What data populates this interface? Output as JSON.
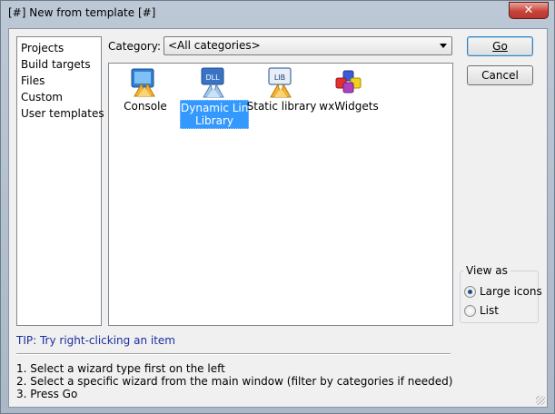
{
  "window": {
    "title": "[#] New from template [#]",
    "close_glyph": "✕"
  },
  "sidebar": {
    "items": [
      {
        "label": "Projects"
      },
      {
        "label": "Build targets"
      },
      {
        "label": "Files"
      },
      {
        "label": "Custom"
      },
      {
        "label": "User templates"
      }
    ]
  },
  "category": {
    "label": "Category:",
    "selected": "<All categories>"
  },
  "wizards": [
    {
      "label_line1": "Console",
      "label_line2": "",
      "icon": "console-icon",
      "selected": false
    },
    {
      "label_line1": "Dynamic Link",
      "label_line2": "Library",
      "icon": "dll-icon",
      "icon_text": "DLL",
      "selected": true
    },
    {
      "label_line1": "Static library",
      "label_line2": "",
      "icon": "lib-icon",
      "icon_text": "LIB",
      "selected": false
    },
    {
      "label_line1": "wxWidgets",
      "label_line2": "",
      "icon": "wxwidgets-icon",
      "selected": false
    }
  ],
  "buttons": {
    "go_label": "Go",
    "cancel_label": "Cancel"
  },
  "view_as": {
    "legend": "View as",
    "options": [
      {
        "label": "Large icons",
        "checked": true
      },
      {
        "label": "List",
        "checked": false
      }
    ]
  },
  "tip": "TIP: Try right-clicking an item",
  "instructions": [
    "1. Select a wizard type first on the left",
    "2. Select a specific wizard from the main window (filter by categories if needed)",
    "3. Press Go"
  ],
  "colors": {
    "selection": "#3399ff",
    "tip_text": "#1a2ea0",
    "close_button": "#c7443a"
  }
}
